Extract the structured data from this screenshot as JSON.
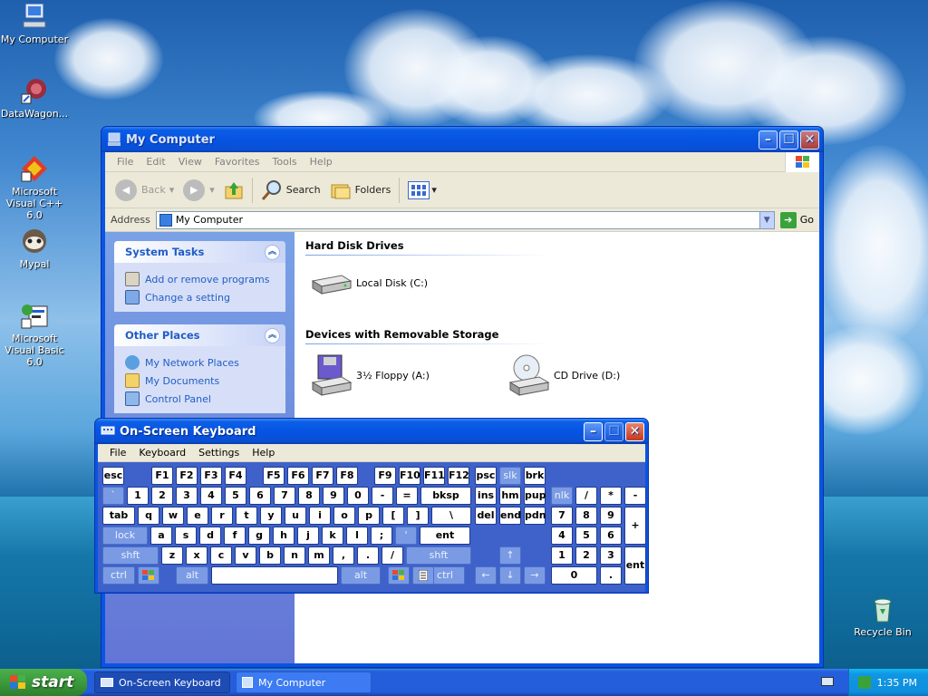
{
  "desktop": {
    "icons": [
      {
        "label": "My Computer"
      },
      {
        "label": "DataWagon..."
      },
      {
        "label": "Microsoft Visual C++ 6.0"
      },
      {
        "label": "Mypal"
      },
      {
        "label": "Microsoft Visual Basic 6.0"
      },
      {
        "label": "Recycle Bin"
      }
    ]
  },
  "explorer": {
    "title": "My Computer",
    "menu": [
      "File",
      "Edit",
      "View",
      "Favorites",
      "Tools",
      "Help"
    ],
    "toolbar": {
      "back": "Back",
      "search": "Search",
      "folders": "Folders"
    },
    "address": {
      "label": "Address",
      "value": "My Computer",
      "go": "Go"
    },
    "system_tasks": {
      "title": "System Tasks",
      "links": [
        "Add or remove programs",
        "Change a setting"
      ]
    },
    "other_places": {
      "title": "Other Places",
      "links": [
        "My Network Places",
        "My Documents",
        "Control Panel"
      ]
    },
    "groups": {
      "hard_disk": {
        "title": "Hard Disk Drives",
        "items": [
          "Local Disk (C:)"
        ]
      },
      "removable": {
        "title": "Devices with Removable Storage",
        "items": [
          "3½ Floppy (A:)",
          "CD Drive (D:)"
        ]
      }
    }
  },
  "osk": {
    "title": "On-Screen Keyboard",
    "menu": [
      "File",
      "Keyboard",
      "Settings",
      "Help"
    ],
    "rows": [
      [
        "esc",
        "F1",
        "F2",
        "F3",
        "F4",
        "F5",
        "F6",
        "F7",
        "F8",
        "F9",
        "F10",
        "F11",
        "F12",
        "psc",
        "slk",
        "brk"
      ],
      [
        "`",
        "1",
        "2",
        "3",
        "4",
        "5",
        "6",
        "7",
        "8",
        "9",
        "0",
        "-",
        "=",
        "bksp",
        "ins",
        "hm",
        "pup",
        "nlk",
        "/",
        "*",
        "-"
      ],
      [
        "tab",
        "q",
        "w",
        "e",
        "r",
        "t",
        "y",
        "u",
        "i",
        "o",
        "p",
        "[",
        "]",
        "\\",
        "del",
        "end",
        "pdn",
        "7",
        "8",
        "9",
        "+"
      ],
      [
        "lock",
        "a",
        "s",
        "d",
        "f",
        "g",
        "h",
        "j",
        "k",
        "l",
        ";",
        "'",
        "ent",
        "4",
        "5",
        "6"
      ],
      [
        "shft",
        "z",
        "x",
        "c",
        "v",
        "b",
        "n",
        "m",
        ",",
        ".",
        "/",
        "shft",
        "↑",
        "1",
        "2",
        "3",
        "ent"
      ],
      [
        "ctrl",
        "alt",
        "alt",
        "ctrl",
        "←",
        "↓",
        "→",
        "0",
        "."
      ]
    ]
  },
  "taskbar": {
    "start": "start",
    "tasks": [
      "On-Screen Keyboard",
      "My Computer"
    ],
    "clock": "1:35 PM"
  }
}
